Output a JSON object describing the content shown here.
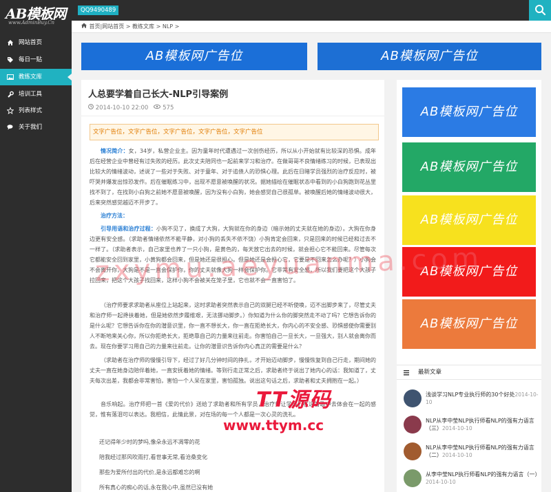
{
  "header": {
    "logo_main": "AB模板网",
    "logo_sub": "www.AdminBuy.Cn",
    "qq_badge": "QQ9490489"
  },
  "sidebar": {
    "items": [
      {
        "icon": "home-icon",
        "label": "网站首页"
      },
      {
        "icon": "tag-icon",
        "label": "每日一贴"
      },
      {
        "icon": "image-icon",
        "label": "教练文库"
      },
      {
        "icon": "wrench-icon",
        "label": "培训工具"
      },
      {
        "icon": "star-icon",
        "label": "列表样式"
      },
      {
        "icon": "chat-icon",
        "label": "关于我们"
      }
    ],
    "active_index": 2
  },
  "breadcrumb": {
    "items": [
      "首页",
      "网站首页",
      "教练文库",
      "NLP"
    ],
    "separator": ">"
  },
  "ads": {
    "banner_text": "AB模板网广告位",
    "colors": {
      "top_left": "#1b6fd8",
      "top_right": "#1d6fd4",
      "blue": "#2b7be4",
      "green": "#23a866",
      "yellow": "#f7e11e",
      "red": "#f21b1b",
      "orange": "#ec7a3c"
    }
  },
  "article": {
    "title": "人总要学着自己长大-NLP引导案例",
    "date": "2014-10-10 22:00",
    "views": "575",
    "text_ads": "文字广告位，文字广告位，文字广告位，文字广告位，文字广告位",
    "p1_label": "情况简介：",
    "p1_text": "女，34岁，私营企业主。因为童年时代遭遇过一次创伤经历，所以从小开始就有比较深的恐惧。成年后在经营企业中曾经有过失败的经历。此次丈夫陪同也一起前来学习和治疗。在做哥哥不良情绪练习的时候，已表现出比较大的情绪波动，述说了一些对于失败、对于童年、对于追债人的恐惧心理。此后在日睹学员强烈的治疗反应时，被吓哭并爆发出惊恐发作。后在催眠练习中，出现不愿意被唤醒的状况。据她描绘在催眠状态中看到的小白狗跑到花丛里找不到了，在找到小白狗之前她不愿意被唤醒，因为没有小白狗，她会感觉自己很孤单。被唤醒后她的情绪波动很大，后来突然感觉越迈不开步了。",
    "p2_label": "治疗方法：",
    "p3_label": "引导用语和治疗过程：",
    "p3_text": "小狗不见了，换成了大狗，大狗就在你的身边（暗示她的丈夫就在她的身边）。大狗在你身边更有安全感。（求助者情绪依然不能平静，对小狗的丢失不依不饶）小狗肯定会回来，只是回来的时候已经和过去不一样了。（求助者表示，自己家里也养了一只小狗，是黄色的，每天放它出去的时候，就会担心它不能回来。尽管每次它都能安全回到家里，小黄狗都会回来，但是她还是很担心。但是她还是会担心它，它要是不回来怎么办呢？）小狗会不会离开你，大狗是不是一直会保护你，你的丈夫就像大狗一样会保护你。它非常有安全感，所以我们要把这个大孩子拉回来，把这个大孩子找回来，这样小狗不会被关在笼子里，它也就不会一直害怕了。",
    "p4_text": "（治疗师要求求助者从座位上站起来，这时求助者突然表示自己的双腿已经不听使唤，迈不出脚步来了，尽管丈夫和治疗师一起搀扶着她，但是她依然步履维艰，无法挪动脚步。）你知道为什么你的脚突然走不动了吗？它想告诉你的是什么呢？它想告诉你在你的潜意识里，你一直不想长大，你一直在拒绝长大，你内心的不安全感、恐惧感使你需要别人不断地来关心你，所以你拒绝长大，拒绝靠自己的力量来往前走。你害怕自己一旦长大，一旦强大，别人就会离你而去。现在你要学习用自己的力量来往前走。让你的潜意识告诉你内心真正的需要是什么？",
    "p5_text": "（求助者在治疗师的慢慢引导下，经过了好几分钟时间的挣扎，才开始迈动脚步，慢慢恢复到自己行走，期间她的丈夫一直在她身边陪伴着她，一直安抚着她的情绪。等到行走正常之后，求助者终于说出了她内心的话：我知道了，丈夫每次出差，我都会非常害怕，害怕一个人呆在家里，害怕孤独。说出这句话之后，求助者和丈夫拥抱在一起。）",
    "p6_text": "音乐响起。治疗师把一首《爱的代价》送给了求助者和所有学员，治疗师让学员们在这首歌中去体会在一起的感觉，惟有落泪可以表达。我相信，此情此景，对在场的每一个人都是一次心灵的洗礼。",
    "poem": [
      "还记得年少时的梦吗,像朵永远不凋零的花",
      "陪我经过那风吹雨打,看世事无常,看沧桑变化",
      "那些为爱所付出的代价,是永远都难忘的啊",
      "所有真心的痴心的话,永在我心中,虽然已没有她"
    ]
  },
  "recent": {
    "title": "最新文章",
    "items": [
      {
        "title": "浅谈学习NLP专业执行师的30个好处",
        "date": "2014-10-10",
        "color": "#3f5470"
      },
      {
        "title": "NLP从李中莹NLP执行师看NLP的强有力语言（三）",
        "date": "2014-10-10",
        "color": "#8a3a4c"
      },
      {
        "title": "NLP从李中莹NLP执行师看NLP的强有力语言（二）",
        "date": "2014-10-10",
        "color": "#a15b2f"
      },
      {
        "title": "从李中莹NLP执行师看NLP的强有力语言（一）",
        "date": "2014-10-10",
        "color": "#7a9a6a"
      }
    ]
  },
  "watermark": {
    "domain": "zxymu.aeyuanma.com",
    "logo_text": "TT源码",
    "url": "www.ttym.cc"
  }
}
